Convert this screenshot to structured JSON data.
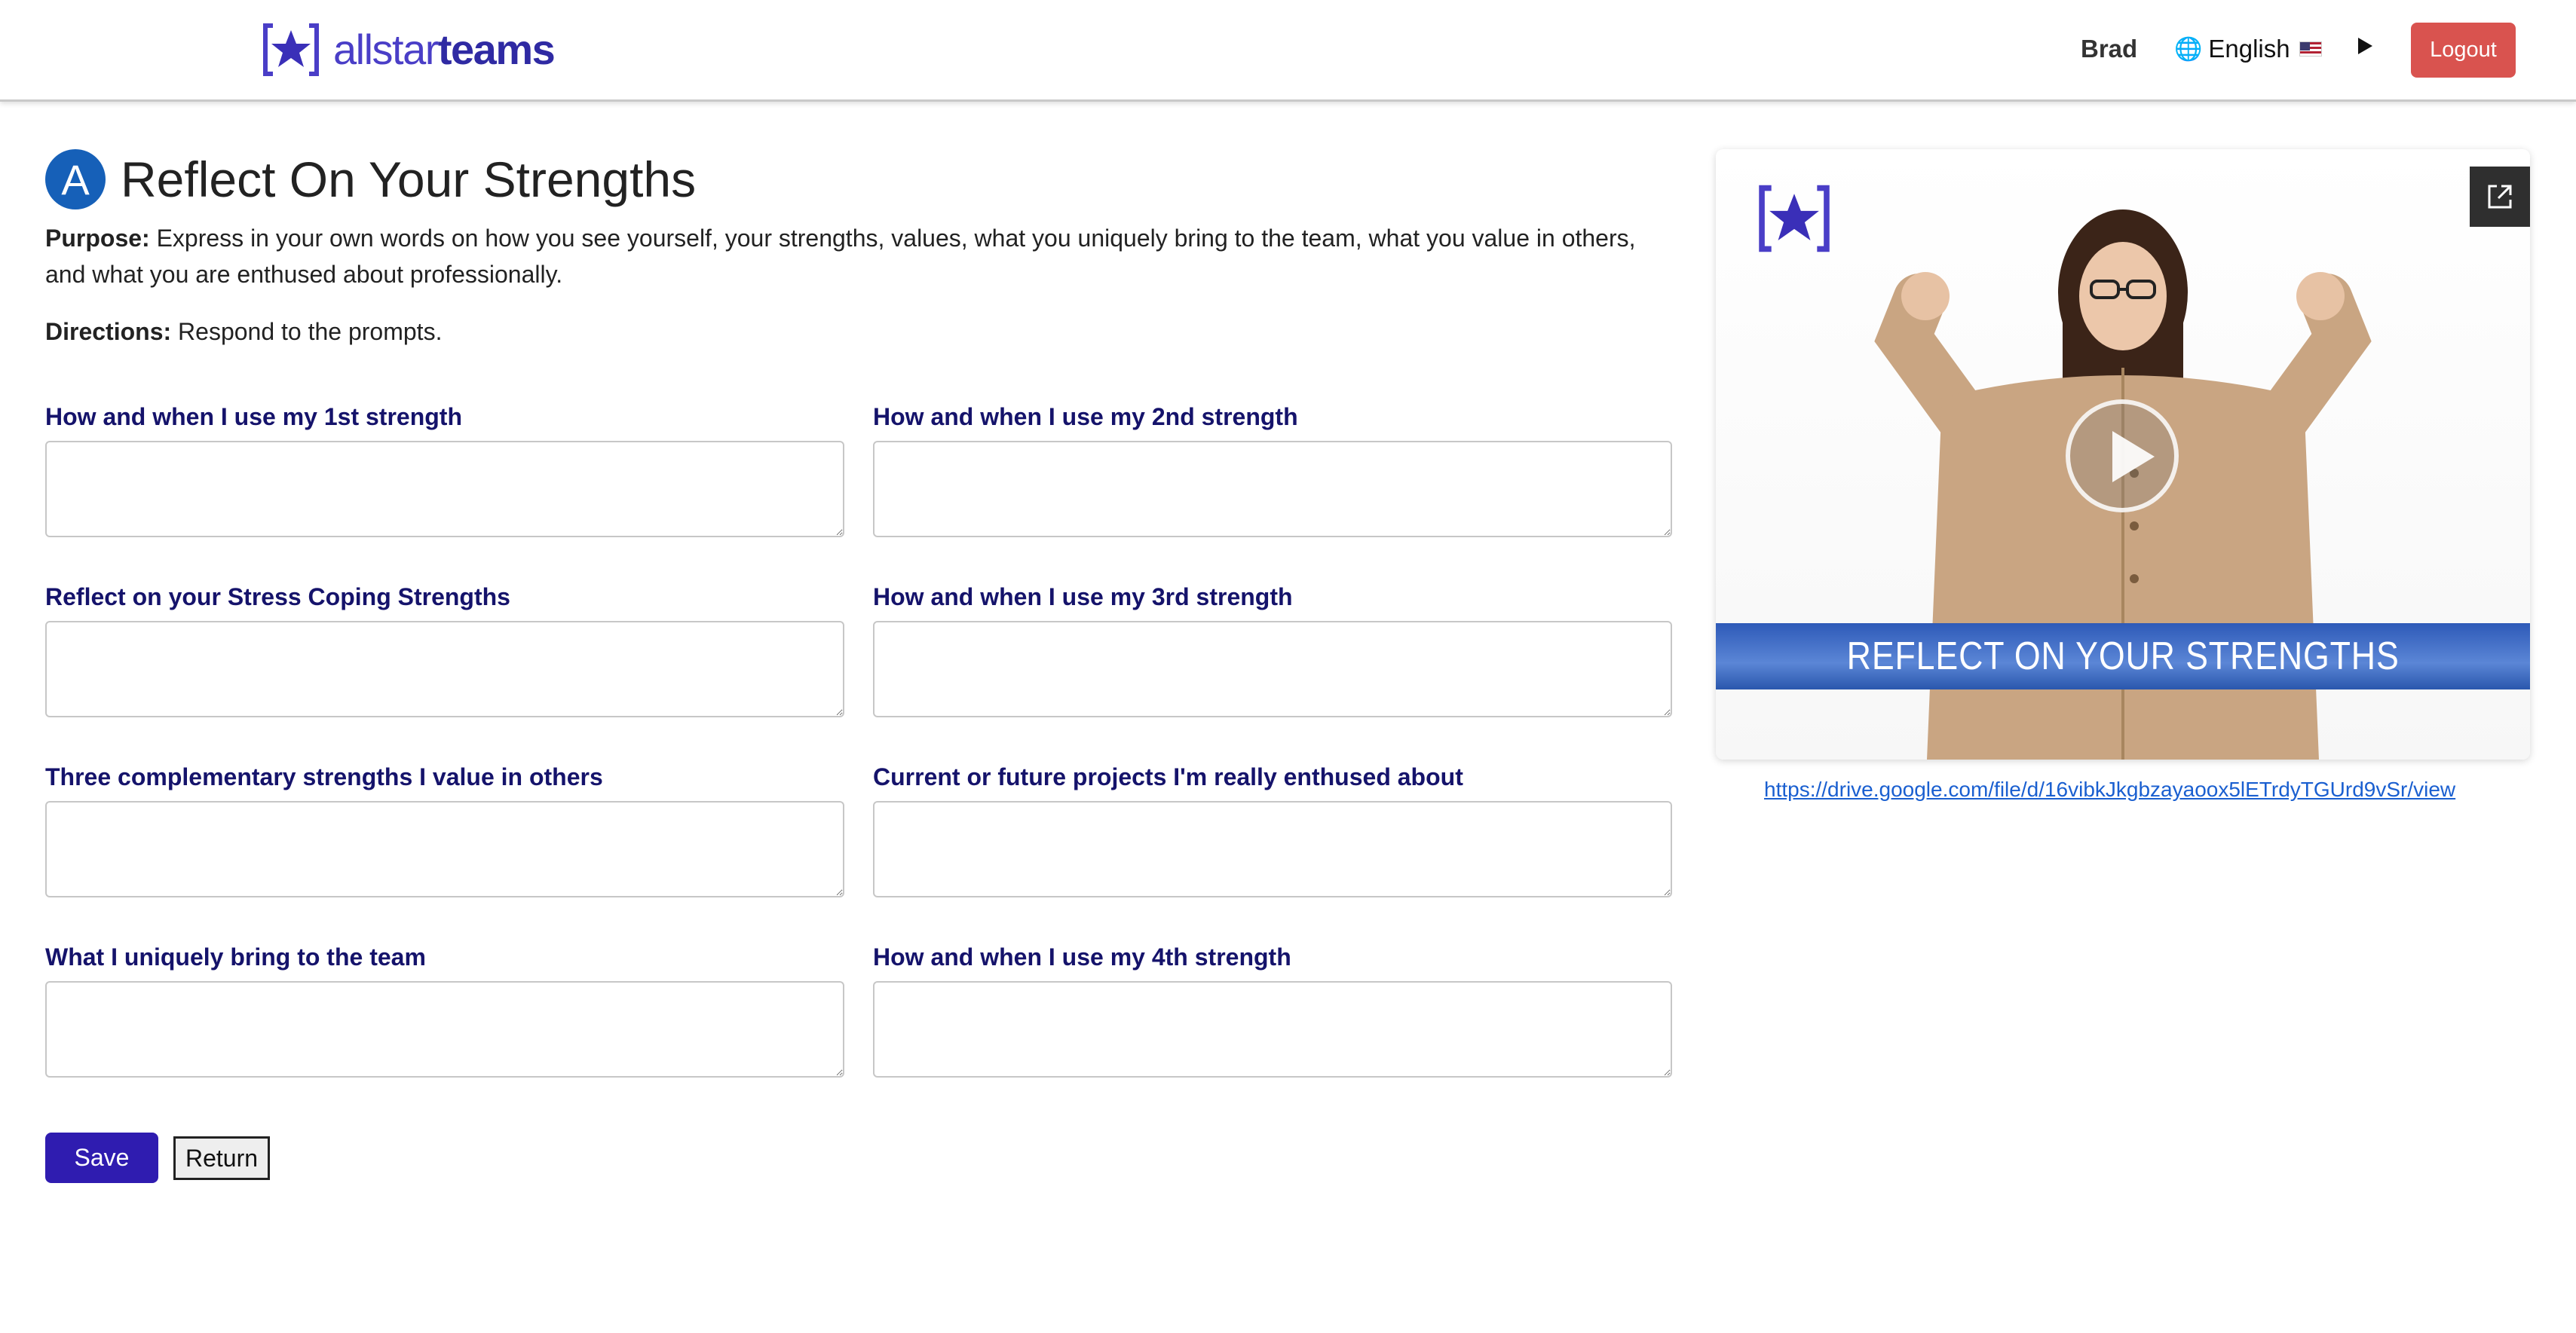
{
  "header": {
    "brand": {
      "light": "allstar",
      "bold": "teams"
    },
    "user_name": "Brad",
    "language": "English",
    "logout_label": "Logout",
    "accent_color": "#2f1cb0"
  },
  "main": {
    "step_badge": "A",
    "title": "Reflect On Your Strengths",
    "purpose_label": "Purpose:",
    "purpose_text": "Express in your own words on how you see yourself, your strengths, values, what you uniquely bring to the team, what you value in others, and what you are enthused about professionally.",
    "directions_label": "Directions:",
    "directions_text": "Respond to the prompts."
  },
  "fields": [
    {
      "label": "How and when I use my 1st strength",
      "value": ""
    },
    {
      "label": "How and when I use my 2nd strength",
      "value": ""
    },
    {
      "label": "Reflect on your Stress Coping Strengths",
      "value": ""
    },
    {
      "label": "How and when I use my 3rd strength",
      "value": ""
    },
    {
      "label": "Three complementary strengths I value in others",
      "value": ""
    },
    {
      "label": "Current or future projects I'm really enthused about",
      "value": ""
    },
    {
      "label": "What I uniquely bring to the team",
      "value": ""
    },
    {
      "label": "How and when I use my 4th strength",
      "value": ""
    }
  ],
  "actions": {
    "save_label": "Save",
    "return_label": "Return"
  },
  "video": {
    "banner_text": "REFLECT ON YOUR STRENGTHS",
    "link": "https://drive.google.com/file/d/16vibkJkgbzayaoox5lETrdyTGUrd9vSr/view"
  },
  "icons": {
    "globe": "globe-icon",
    "flag": "us-flag-icon",
    "play": "play-icon",
    "open_external": "open-external-icon"
  }
}
